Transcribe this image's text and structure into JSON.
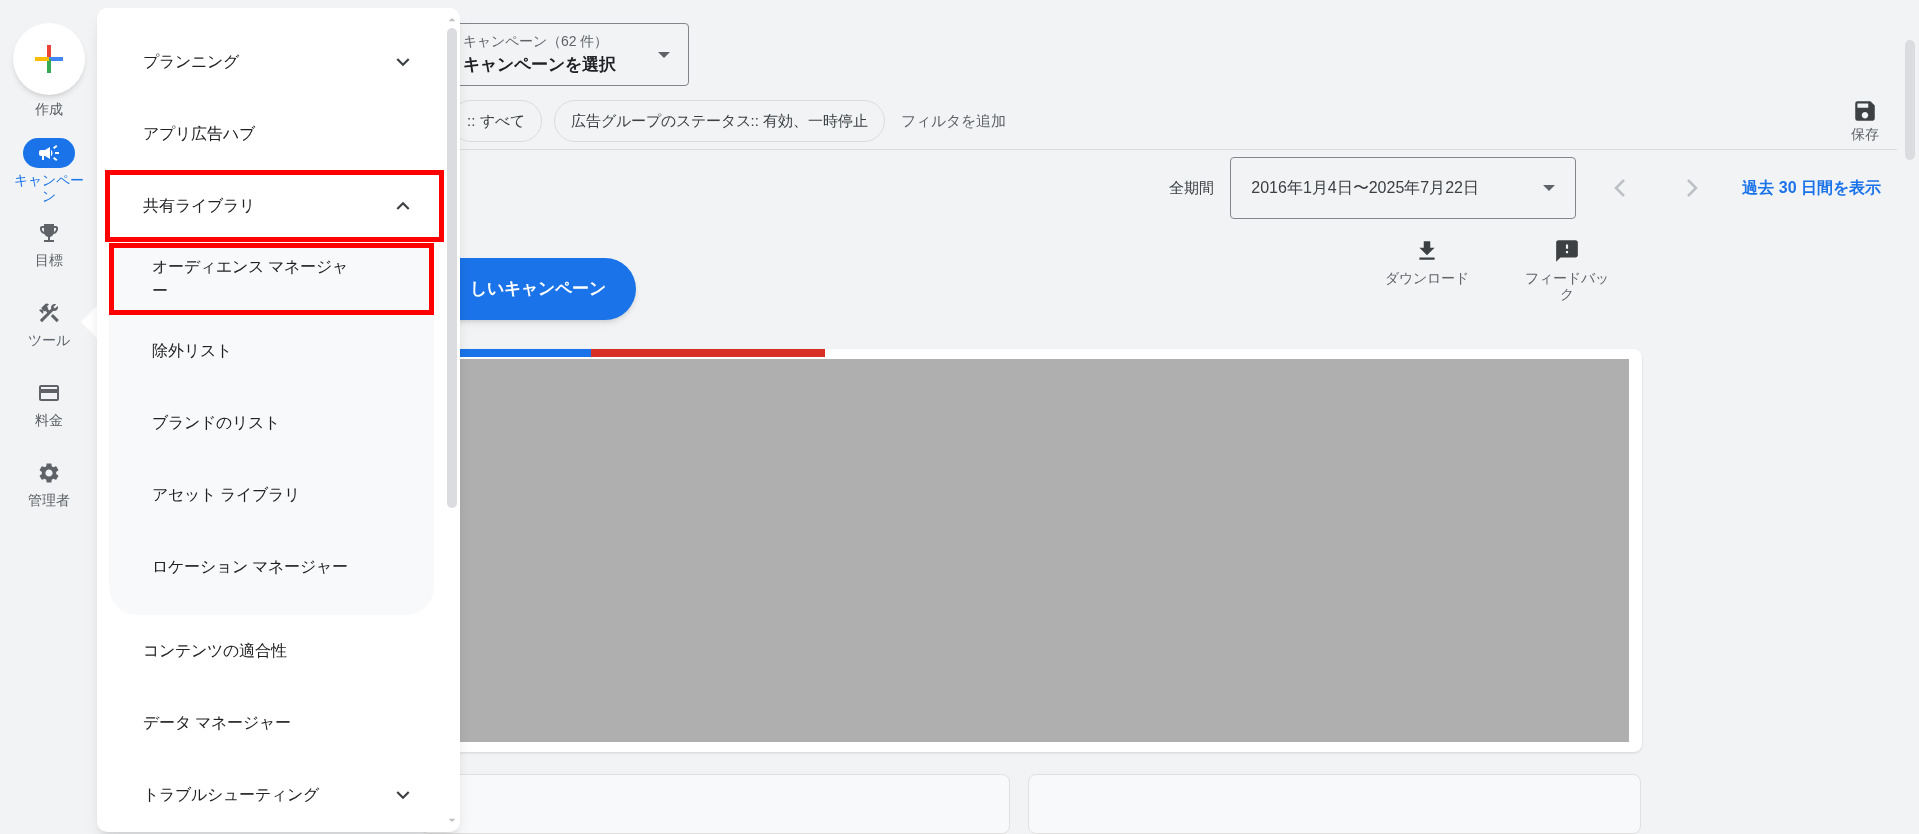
{
  "rail": [
    {
      "label": "作成",
      "kind": "create"
    },
    {
      "label": "キャンペーン",
      "kind": "campaign",
      "selected": true
    },
    {
      "label": "目標",
      "kind": "goals",
      "selected": false
    },
    {
      "label": "ツール",
      "kind": "tools",
      "selected": false,
      "menu_open": true
    },
    {
      "label": "料金",
      "kind": "billing",
      "selected": false
    },
    {
      "label": "管理者",
      "kind": "admin",
      "selected": false
    }
  ],
  "tools_menu": [
    {
      "label": "プランニング",
      "expanded": false,
      "outlined": false
    },
    {
      "label": "アプリ広告ハブ",
      "outlined": false
    },
    {
      "label": "共有ライブラリ",
      "expanded": true,
      "outlined": true,
      "children": [
        {
          "label": "オーディエンス マネージャー",
          "outlined": true
        },
        {
          "label": "除外リスト",
          "outlined": false
        },
        {
          "label": "ブランドのリスト",
          "outlined": false
        },
        {
          "label": "アセット ライブラリ",
          "outlined": false
        },
        {
          "label": "ロケーション マネージャー",
          "outlined": false
        }
      ]
    },
    {
      "label": "コンテンツの適合性",
      "outlined": false
    },
    {
      "label": "データ マネージャー",
      "outlined": false
    },
    {
      "label": "トラブルシューティング",
      "expanded": false,
      "outlined": false
    }
  ],
  "campaign_selector": {
    "caption": "キャンペーン（62 件）",
    "value": "キャンペーンを選択"
  },
  "filters": [
    {
      "label": ":: すべて",
      "kind": "chip"
    },
    {
      "label": "広告グループのステータス:: 有効、一時停止",
      "kind": "chip"
    },
    {
      "label": "フィルタを追加",
      "kind": "add"
    }
  ],
  "save_button": "保存",
  "date_range": {
    "label": "全期間",
    "value": "2016年1月4日〜2025年7月22日",
    "link": "過去 30 日間を表示"
  },
  "new_campaign_button": "しいキャンペーン",
  "actions": [
    {
      "label": "ダウンロード",
      "kind": "download"
    },
    {
      "label": "フィードバック",
      "kind": "feedback"
    }
  ]
}
